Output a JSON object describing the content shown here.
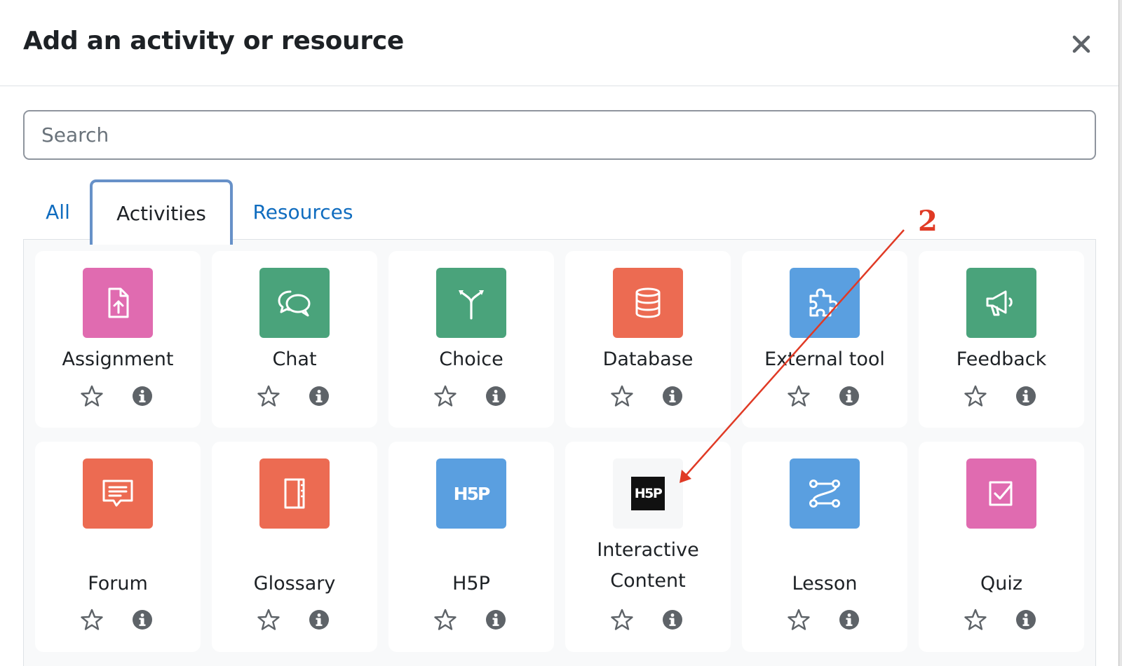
{
  "modal": {
    "title": "Add an activity or resource",
    "close_label": "×"
  },
  "search": {
    "placeholder": "Search",
    "value": ""
  },
  "tabs": [
    {
      "label": "All",
      "selected": false
    },
    {
      "label": "Activities",
      "selected": true
    },
    {
      "label": "Resources",
      "selected": false
    }
  ],
  "items": [
    {
      "label": "Assignment",
      "icon": "assignment-icon",
      "color": "#e06bb0"
    },
    {
      "label": "Chat",
      "icon": "chat-icon",
      "color": "#4aa37b"
    },
    {
      "label": "Choice",
      "icon": "choice-icon",
      "color": "#4aa37b"
    },
    {
      "label": "Database",
      "icon": "database-icon",
      "color": "#ec6b52"
    },
    {
      "label": "External tool",
      "icon": "puzzle-icon",
      "color": "#5a9fe0"
    },
    {
      "label": "Feedback",
      "icon": "megaphone-icon",
      "color": "#4aa37b"
    },
    {
      "label": "Forum",
      "icon": "forum-icon",
      "color": "#ec6b52"
    },
    {
      "label": "Glossary",
      "icon": "glossary-icon",
      "color": "#ec6b52"
    },
    {
      "label": "H5P",
      "icon": "h5p-icon",
      "color": "#5a9fe0",
      "icon_text": "H5P"
    },
    {
      "label": "Interactive Content",
      "label_line1": "Interactive",
      "label_line2": "Content",
      "icon": "h5p-logo-icon",
      "color": "#f8f9fa",
      "icon_text": "H5P"
    },
    {
      "label": "Lesson",
      "icon": "lesson-icon",
      "color": "#5a9fe0"
    },
    {
      "label": "Quiz",
      "icon": "quiz-icon",
      "color": "#e06bb0"
    }
  ],
  "annotation": {
    "number": "2",
    "color": "#e03a25"
  }
}
